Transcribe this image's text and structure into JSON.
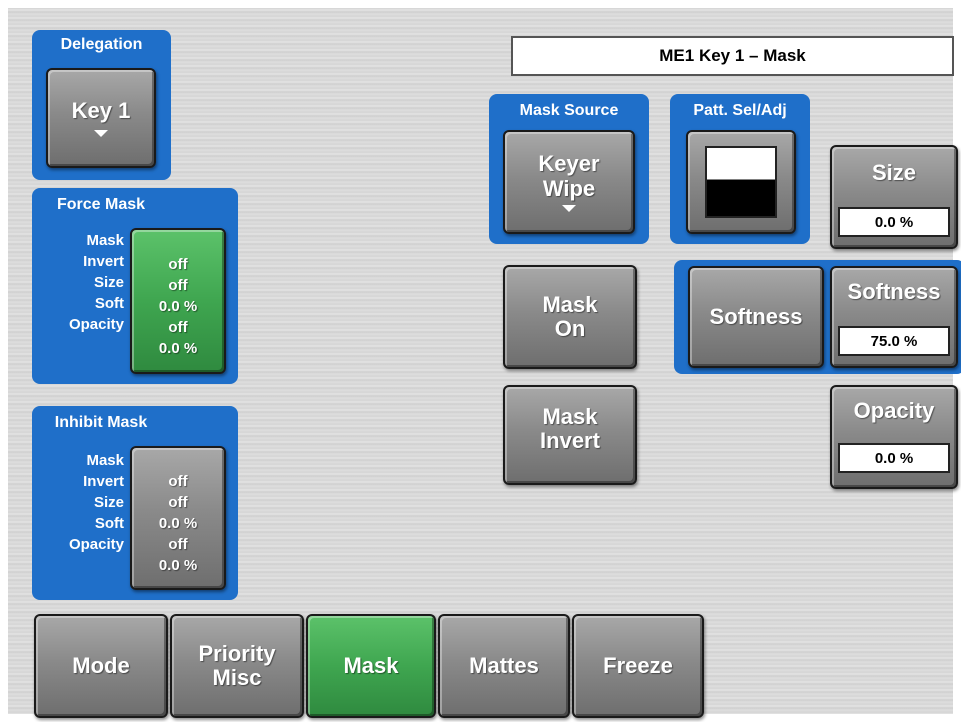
{
  "header": {
    "title": "ME1 Key 1 – Mask"
  },
  "delegation": {
    "title": "Delegation",
    "button_label": "Key 1"
  },
  "force_mask": {
    "title": "Force Mask",
    "rows": [
      {
        "label": "Mask",
        "value": "off"
      },
      {
        "label": "Invert",
        "value": "off"
      },
      {
        "label": "Size",
        "value": "0.0 %"
      },
      {
        "label": "Soft",
        "value": "off"
      },
      {
        "label": "Opacity",
        "value": "0.0 %"
      }
    ]
  },
  "inhibit_mask": {
    "title": "Inhibit Mask",
    "rows": [
      {
        "label": "Mask",
        "value": "off"
      },
      {
        "label": "Invert",
        "value": "off"
      },
      {
        "label": "Size",
        "value": "0.0 %"
      },
      {
        "label": "Soft",
        "value": "off"
      },
      {
        "label": "Opacity",
        "value": "0.0 %"
      }
    ]
  },
  "mask_source": {
    "title": "Mask Source",
    "button_line1": "Keyer",
    "button_line2": "Wipe"
  },
  "pattern": {
    "title": "Patt. Sel/Adj"
  },
  "size": {
    "label": "Size",
    "value": "0.0 %"
  },
  "mask_on": {
    "line1": "Mask",
    "line2": "On"
  },
  "mask_invert": {
    "line1": "Mask",
    "line2": "Invert"
  },
  "softness": {
    "toggle_label": "Softness",
    "label": "Softness",
    "value": "75.0 %"
  },
  "opacity": {
    "label": "Opacity",
    "value": "0.0 %"
  },
  "tabs": [
    {
      "line1": "Mode",
      "line2": ""
    },
    {
      "line1": "Priority",
      "line2": "Misc"
    },
    {
      "line1": "Mask",
      "line2": ""
    },
    {
      "line1": "Mattes",
      "line2": ""
    },
    {
      "line1": "Freeze",
      "line2": ""
    }
  ],
  "active_tab": "Mask",
  "colors": {
    "group_blue": "#1f6fc9",
    "active_green": "#3fa650",
    "button_gray": "#8a8a8a"
  }
}
